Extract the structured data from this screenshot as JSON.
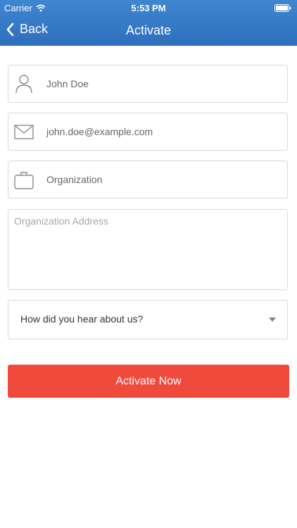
{
  "status_bar": {
    "carrier": "Carrier",
    "time": "5:53 PM",
    "wifi_icon": "wifi-icon",
    "battery_icon": "battery-icon"
  },
  "nav": {
    "back_label": "Back",
    "title": "Activate",
    "back_icon": "chevron-left-icon"
  },
  "form": {
    "name": {
      "value": "",
      "placeholder": "John Doe",
      "icon": "user-icon"
    },
    "email": {
      "value": "",
      "placeholder": "john.doe@example.com",
      "icon": "envelope-icon"
    },
    "organization": {
      "value": "",
      "placeholder": "Organization",
      "icon": "briefcase-icon"
    },
    "address": {
      "value": "",
      "placeholder": "Organization Address"
    },
    "referral": {
      "selected": "How did you hear about us?",
      "icon": "caret-down-icon"
    }
  },
  "submit_label": "Activate Now",
  "colors": {
    "header_top": "#3f86d0",
    "header_bottom": "#2f6fbd",
    "button": "#f04a3c",
    "border": "#d9d9d9"
  }
}
